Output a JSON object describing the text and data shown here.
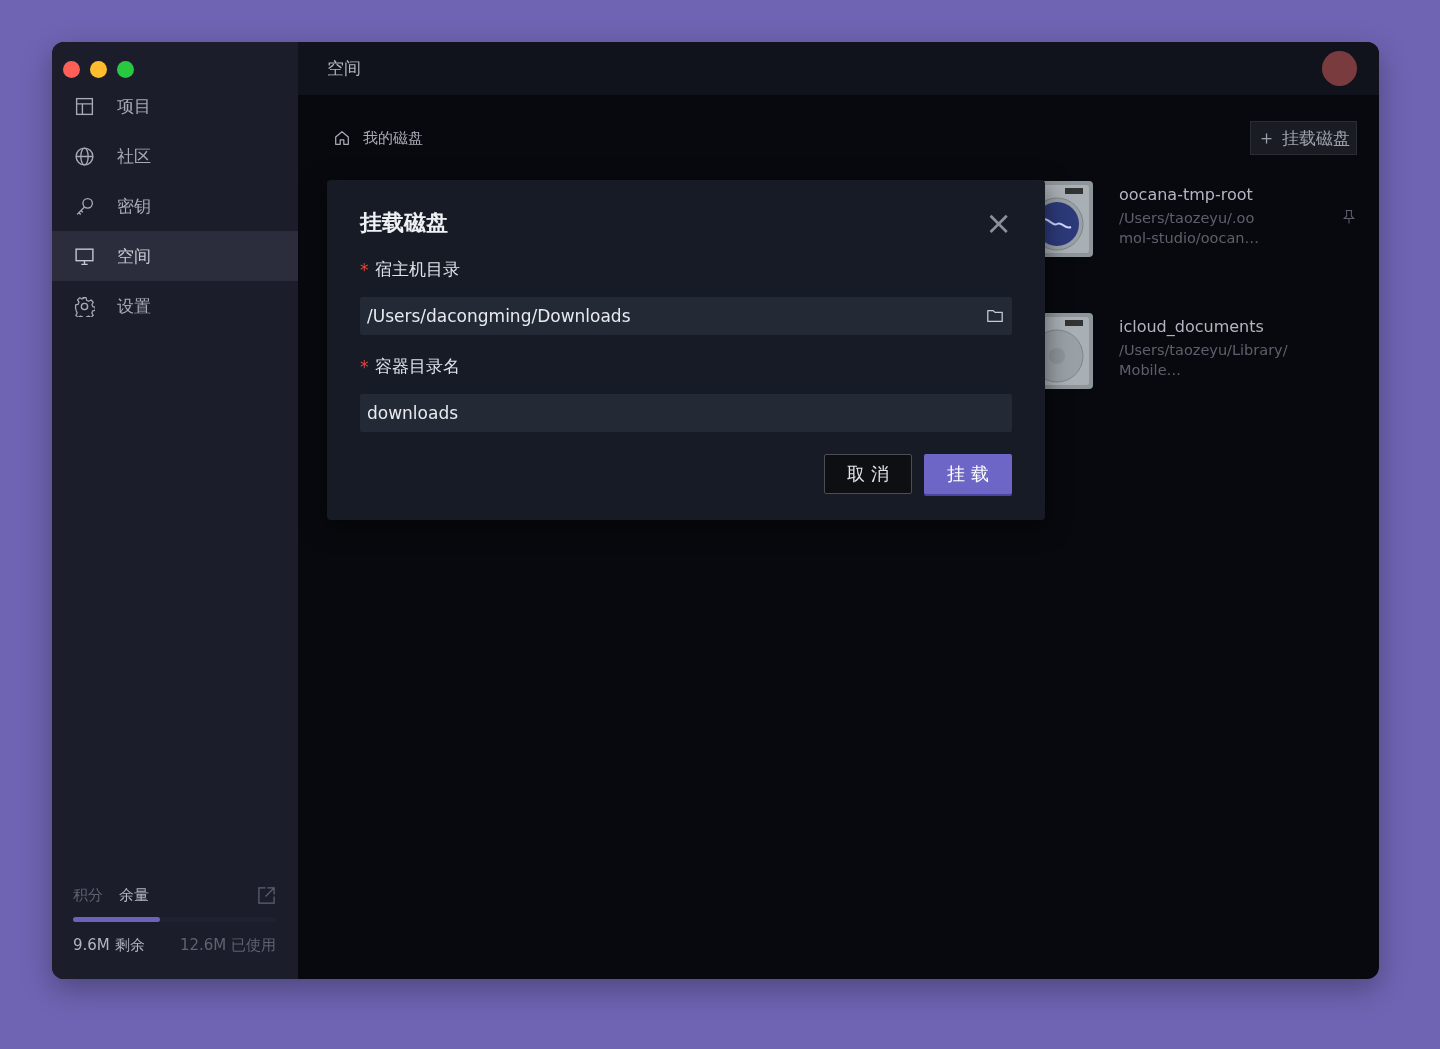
{
  "window": {
    "title": "空间"
  },
  "sidebar": {
    "items": [
      {
        "label": "项目",
        "selected": false
      },
      {
        "label": "社区",
        "selected": false
      },
      {
        "label": "密钥",
        "selected": false
      },
      {
        "label": "空间",
        "selected": true
      },
      {
        "label": "设置",
        "selected": false
      }
    ],
    "quota": {
      "tabs": [
        {
          "label": "积分",
          "selected": false
        },
        {
          "label": "余量",
          "selected": true
        }
      ],
      "level": 0.43,
      "remaining": "9.6M 剩余",
      "used": "12.6M 已使用"
    }
  },
  "breadcrumb": "我的磁盘",
  "mount_button": {
    "icon": "＋",
    "label": "挂载磁盘"
  },
  "disks": [
    {
      "name": "oocana-tmp-root",
      "path": "/Users/taozeyu/.oo",
      "path_2": "mol-studio/oocan…",
      "kind": "logo",
      "pinned": true
    },
    {
      "name": "icloud_documents",
      "path": "/Users/taozeyu/Library/",
      "path_2": "Mobile…",
      "kind": "plain",
      "pinned": false
    }
  ],
  "dialog": {
    "title": "挂载磁盘",
    "close": "×",
    "fields": [
      {
        "required_mark": "*",
        "label": "宿主机目录",
        "value": "/Users/dacongming/Downloads",
        "browse": true
      },
      {
        "required_mark": "*",
        "label": "容器目录名",
        "value": "downloads",
        "browse": false
      }
    ],
    "buttons": [
      {
        "label": "取 消",
        "kind": "secondary"
      },
      {
        "label": "挂 载",
        "kind": "primary"
      }
    ]
  }
}
